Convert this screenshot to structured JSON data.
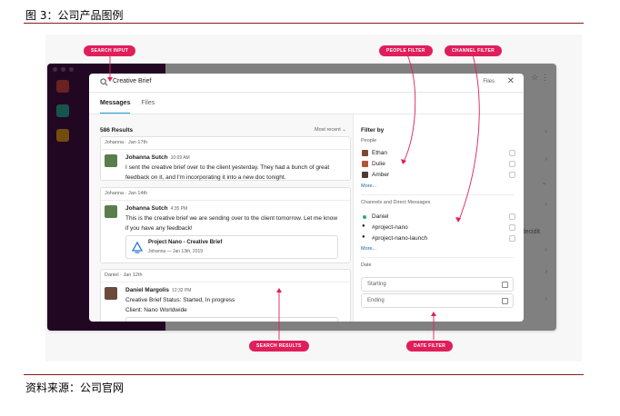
{
  "figure": {
    "title": "图 3：公司产品图例",
    "source": "资料来源：公司官网"
  },
  "callouts": {
    "search_input": "SEARCH INPUT",
    "people_filter": "PEOPLE FILTER",
    "channel_filter": "CHANNEL FILTER",
    "search_results": "SEARCH RESULTS",
    "date_filter": "DATE FILTER"
  },
  "background_app": {
    "partial_text": "decidit"
  },
  "search": {
    "value": "Creative Brief",
    "files_label": "Files",
    "close_glyph": "✕"
  },
  "tabs": [
    {
      "label": "Messages",
      "active": true
    },
    {
      "label": "Files",
      "active": false
    }
  ],
  "results": {
    "count_label": "586 Results",
    "sort_label": "Most recent ⌄",
    "items": [
      {
        "meta": "Johanna · Jan 17th",
        "sender": "Johanna Sutch",
        "time": "10:09 AM",
        "lines": [
          "I sent the creative brief over to the client yesterday. They had a bunch of great",
          "feedback on it, and I'm incorporating it into a new doc tonight."
        ]
      },
      {
        "meta": "Johanna · Jan 14th",
        "sender": "Johanna Sutch",
        "time": "4:35 PM",
        "lines": [
          "This is the creative brief we are sending over to the client tomorrow. Let me know",
          "if you have any feedback!"
        ],
        "attachment": {
          "title": "Project Nano - Creative Brief",
          "subtitle": "Johanna — Jan 13th, 2019"
        }
      },
      {
        "meta": "Daniel · Jan 12th",
        "sender": "Daniel Margolis",
        "time": "12:32 PM",
        "lines": [
          "Creative Brief Status: Started, In progress",
          "Client: Nano Worldwide"
        ]
      }
    ]
  },
  "filters": {
    "title": "Filter by",
    "people_label": "People",
    "people": [
      {
        "name": "Ethan",
        "color": "#7b4a2e"
      },
      {
        "name": "Dulie",
        "color": "#b5523b"
      },
      {
        "name": "Amber",
        "color": "#4a3b33"
      }
    ],
    "more_label": "More...",
    "channels_label": "Channels and Direct Messages",
    "channels": [
      {
        "name": "Daniel",
        "kind": "person"
      },
      {
        "name": "#project-nano",
        "kind": "private"
      },
      {
        "name": "#project-nano-launch",
        "kind": "private"
      }
    ],
    "date_label": "Date",
    "date_start_placeholder": "Starting",
    "date_end_placeholder": "Ending"
  },
  "colors": {
    "callout": "#e01e5a",
    "sidebar": "#3f0e40",
    "tab_active": "#1d9bd1",
    "rule": "#8b1a1a"
  }
}
